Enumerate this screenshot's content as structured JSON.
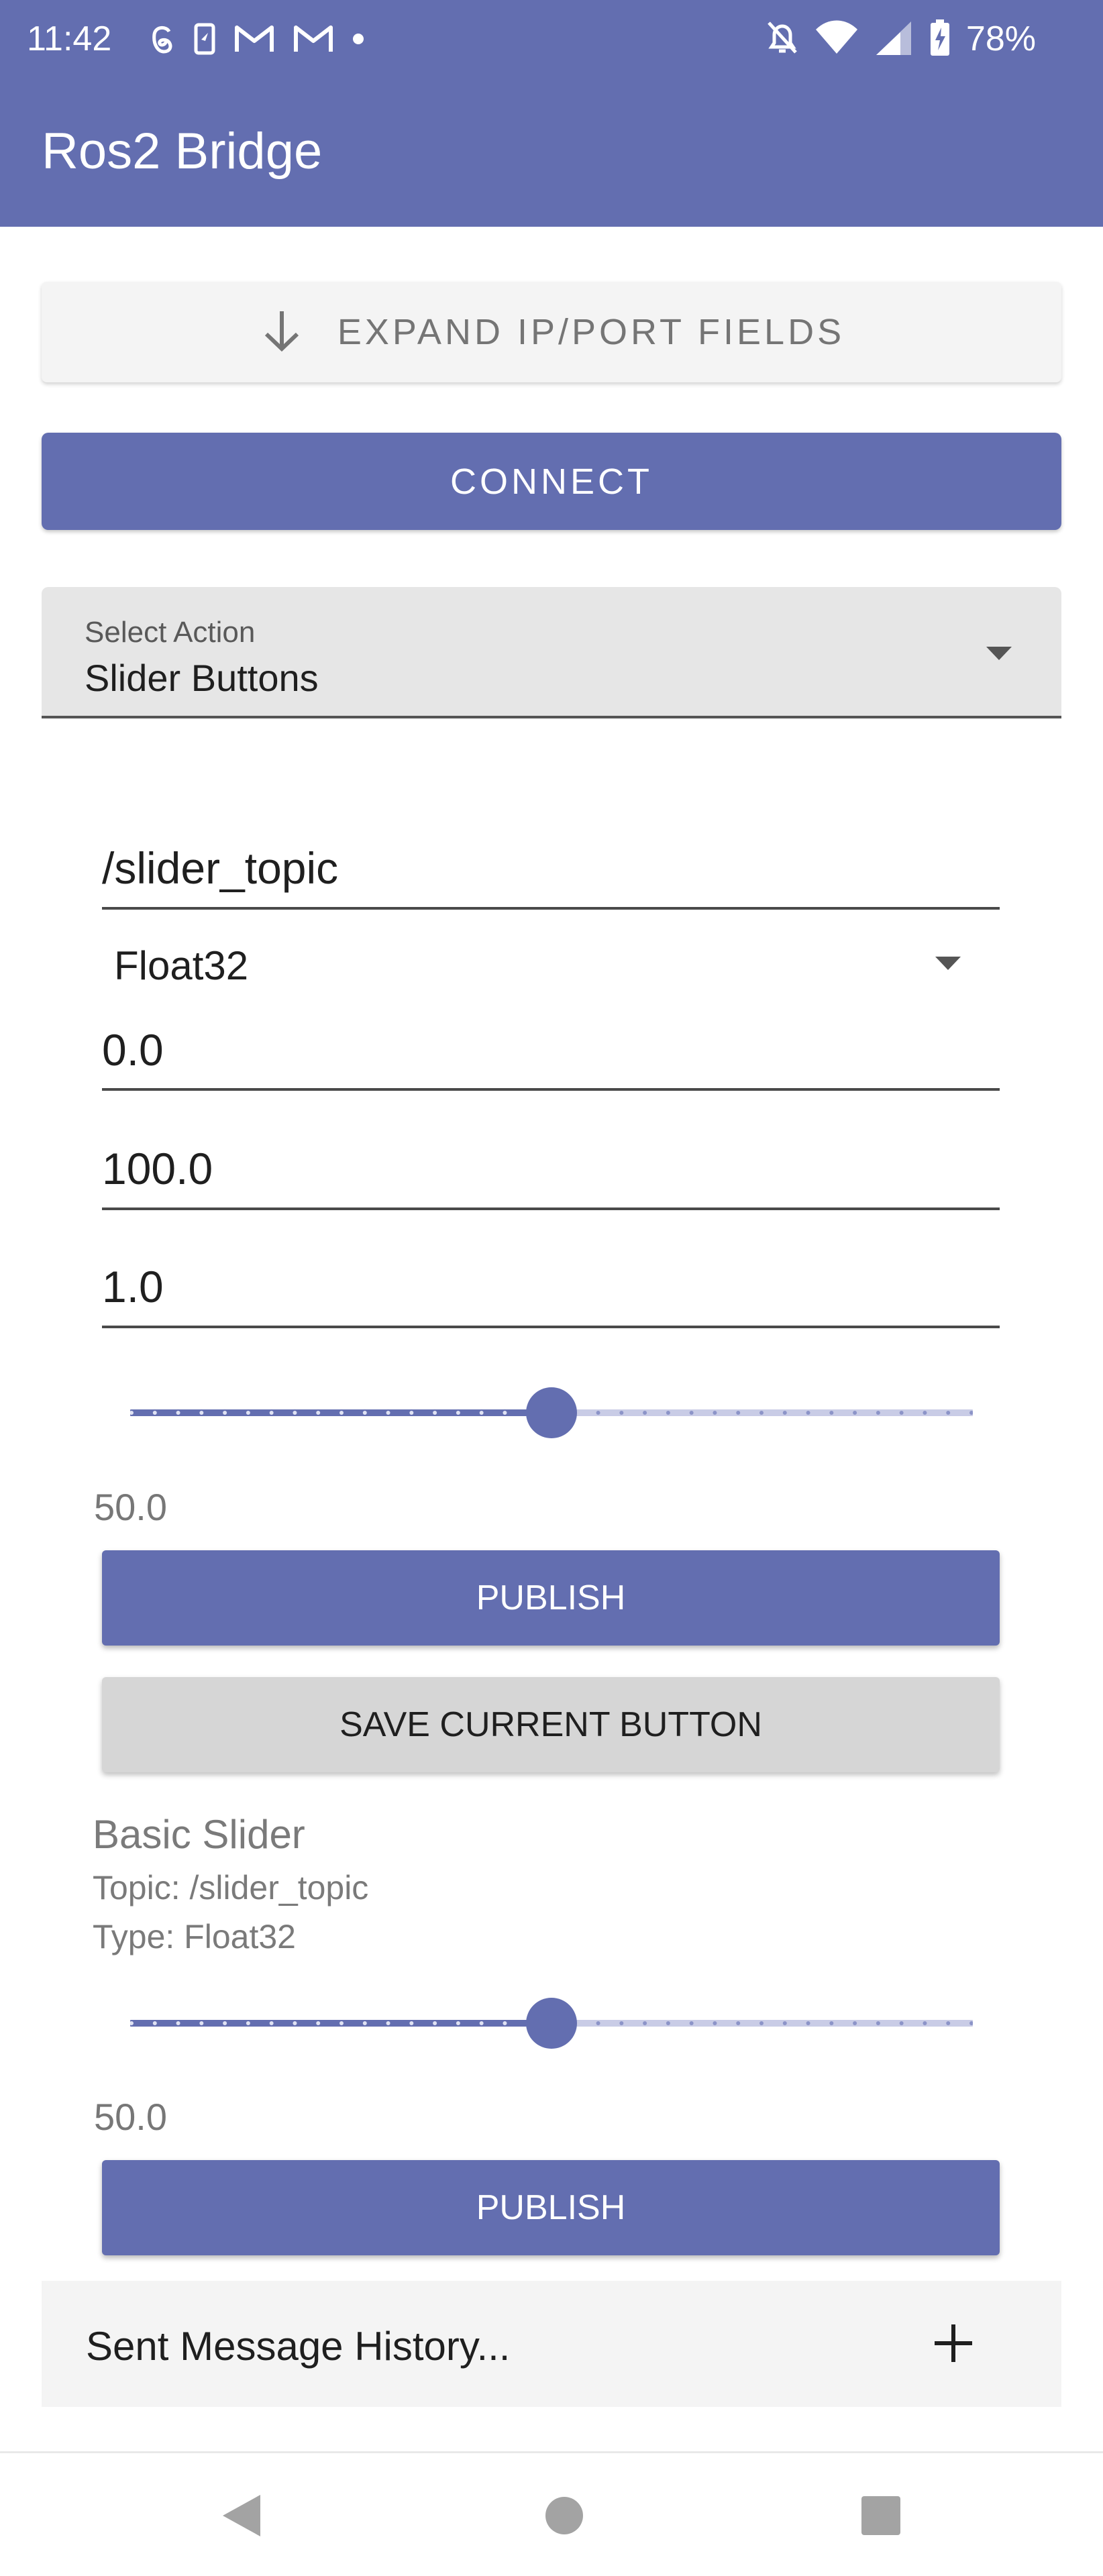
{
  "status_bar": {
    "time": "11:42",
    "battery": "78%",
    "left_icons": [
      "threads-icon",
      "app-notification-icon",
      "gmail-icon",
      "gmail-icon",
      "dot-icon"
    ],
    "right_icons": [
      "bell-off-icon",
      "wifi-icon",
      "signal-icon",
      "battery-charging-icon"
    ]
  },
  "app_bar": {
    "title": "Ros2 Bridge",
    "color": "#636eb0"
  },
  "expand_button": {
    "label": "EXPAND IP/PORT FIELDS"
  },
  "connect_button": {
    "label": "CONNECT"
  },
  "select_action": {
    "label": "Select Action",
    "value": "Slider Buttons"
  },
  "config": {
    "topic": "/slider_topic",
    "type": "Float32",
    "min": "0.0",
    "max": "100.0",
    "step": "1.0"
  },
  "slider": {
    "value_text": "50.0",
    "level": 0.5
  },
  "publish_button": {
    "label": "PUBLISH"
  },
  "save_button": {
    "label": "SAVE CURRENT BUTTON"
  },
  "saved_slider": {
    "name": "Basic Slider",
    "topic_line": "Topic: /slider_topic",
    "type_line": "Type: Float32",
    "value_text": "50.0",
    "level": 0.5,
    "publish_label": "PUBLISH"
  },
  "history": {
    "label": "Sent Message History..."
  }
}
